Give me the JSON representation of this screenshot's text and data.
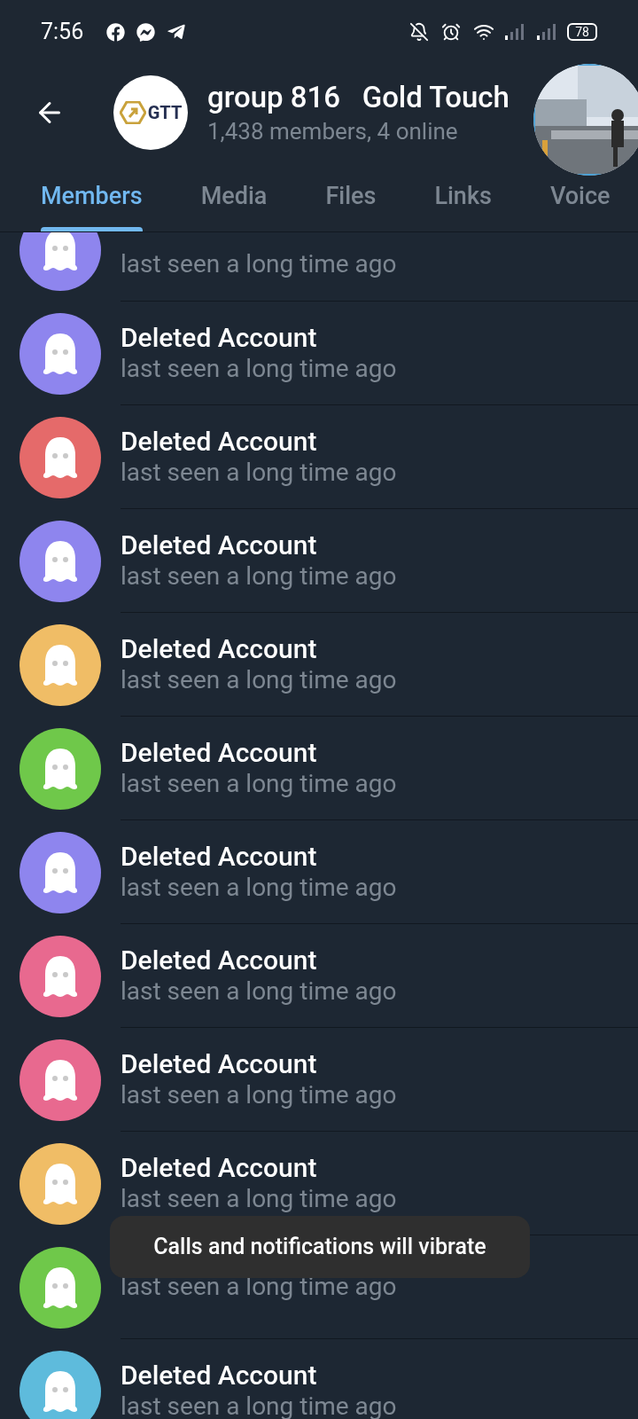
{
  "status_bar": {
    "time": "7:56",
    "battery": "78"
  },
  "header": {
    "logo_text": "GTT",
    "title": "group 816   Gold Touch",
    "subtitle": "1,438 members, 4 online"
  },
  "tabs": [
    {
      "label": "Members",
      "selected": true
    },
    {
      "label": "Media",
      "selected": false
    },
    {
      "label": "Files",
      "selected": false
    },
    {
      "label": "Links",
      "selected": false
    },
    {
      "label": "Voice",
      "selected": false
    }
  ],
  "members": [
    {
      "status": "last seen a long time ago",
      "color": "#8e85ee"
    },
    {
      "name": "Deleted Account",
      "status": "last seen a long time ago",
      "color": "#8e85ee"
    },
    {
      "name": "Deleted Account",
      "status": "last seen a long time ago",
      "color": "#e56a6a"
    },
    {
      "name": "Deleted Account",
      "status": "last seen a long time ago",
      "color": "#8e85ee"
    },
    {
      "name": "Deleted Account",
      "status": "last seen a long time ago",
      "color": "#f0bd66"
    },
    {
      "name": "Deleted Account",
      "status": "last seen a long time ago",
      "color": "#6fc84a"
    },
    {
      "name": "Deleted Account",
      "status": "last seen a long time ago",
      "color": "#8e85ee"
    },
    {
      "name": "Deleted Account",
      "status": "last seen a long time ago",
      "color": "#e8698f"
    },
    {
      "name": "Deleted Account",
      "status": "last seen a long time ago",
      "color": "#e8698f"
    },
    {
      "name": "Deleted Account",
      "status": "last seen a long time ago",
      "color": "#f0bd66"
    },
    {
      "status": "last seen a long time ago",
      "color": "#6fc84a"
    },
    {
      "name": "Deleted Account",
      "status": "last seen a long time ago",
      "color": "#5ebbdc"
    }
  ],
  "toast": {
    "text": "Calls and notifications will vibrate"
  }
}
